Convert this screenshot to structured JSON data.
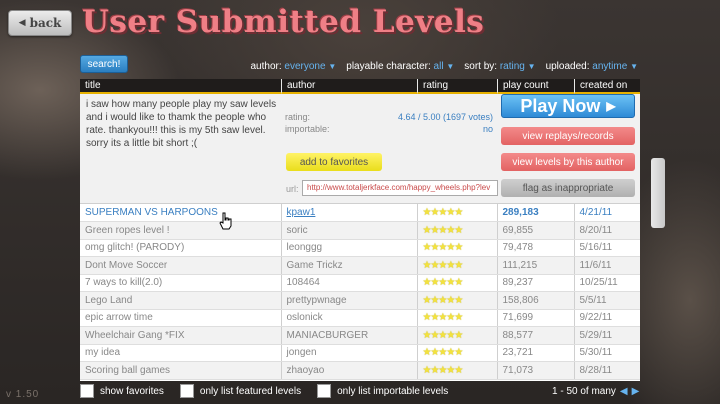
{
  "header": {
    "back_label": "back",
    "title": "User Submitted Levels",
    "search_label": "search!",
    "version": "v 1.50"
  },
  "filters": [
    {
      "label": "author:",
      "value": "everyone"
    },
    {
      "label": "playable character:",
      "value": "all"
    },
    {
      "label": "sort by:",
      "value": "rating"
    },
    {
      "label": "uploaded:",
      "value": "anytime"
    }
  ],
  "columns": [
    "title",
    "author",
    "rating",
    "play count",
    "created on"
  ],
  "detail": {
    "description": "i saw how many people play my saw levels and i would like to thamk the people who rate. thankyou!!! this is my 5th saw level. sorry its a little bit short ;(",
    "rating_label": "rating:",
    "rating_value": "4.64 / 5.00 (1697 votes)",
    "importable_label": "importable:",
    "importable_value": "no",
    "favorites_label": "add to favorites",
    "url_label": "url:",
    "url_value": "http://www.totaljerkface.com/happy_wheels.php?lev",
    "play_label": "Play Now",
    "replays_label": "view replays/records",
    "author_levels_label": "view levels by this author",
    "flag_label": "flag as inappropriate"
  },
  "rows": [
    {
      "title": "SUPERMAN VS HARPOONS",
      "author": "kpaw1",
      "stars": "★★★★★",
      "plays": "289,183",
      "date": "4/21/11",
      "selected": true
    },
    {
      "title": "Green ropes level !",
      "author": "soric",
      "stars": "★★★★★",
      "plays": "69,855",
      "date": "8/20/11"
    },
    {
      "title": "omg glitch! (PARODY)",
      "author": "leonggg",
      "stars": "★★★★★",
      "plays": "79,478",
      "date": "5/16/11"
    },
    {
      "title": "Dont Move Soccer",
      "author": "Game Trickz",
      "stars": "★★★★★",
      "plays": "111,215",
      "date": "11/6/11"
    },
    {
      "title": "7 ways to kill(2.0)",
      "author": "108464",
      "stars": "★★★★★",
      "plays": "89,237",
      "date": "10/25/11"
    },
    {
      "title": "Lego Land",
      "author": "prettypwnage",
      "stars": "★★★★★",
      "plays": "158,806",
      "date": "5/5/11"
    },
    {
      "title": "epic arrow time",
      "author": "oslonick",
      "stars": "★★★★★",
      "plays": "71,699",
      "date": "9/22/11"
    },
    {
      "title": "Wheelchair Gang *FIX",
      "author": "MANIACBURGER",
      "stars": "★★★★★",
      "plays": "88,577",
      "date": "5/29/11"
    },
    {
      "title": "my idea",
      "author": "jongen",
      "stars": "★★★★★",
      "plays": "23,721",
      "date": "5/30/11"
    },
    {
      "title": "Scoring ball games",
      "author": "zhaoyao",
      "stars": "★★★★★",
      "plays": "71,073",
      "date": "8/28/11"
    }
  ],
  "bottom": {
    "favorites_label": "show favorites",
    "featured_label": "only list featured levels",
    "importable_label": "only list importable levels",
    "pager_label": "1 - 50 of many"
  }
}
